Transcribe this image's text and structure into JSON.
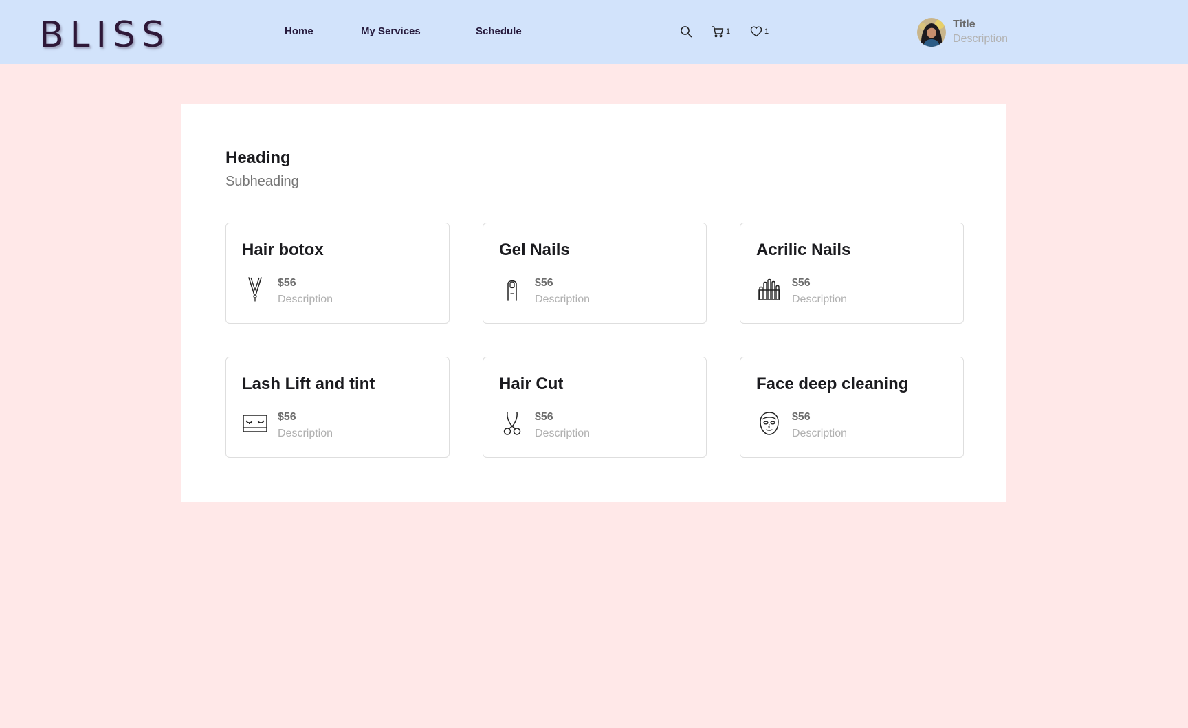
{
  "brand": {
    "logo_text": "BLISS",
    "logo_color": "#2e1838"
  },
  "nav": {
    "items": [
      {
        "label": "Home"
      },
      {
        "label": "My Services"
      },
      {
        "label": "Schedule"
      }
    ]
  },
  "header_actions": {
    "search_icon": "search-icon",
    "cart_icon": "cart-icon",
    "cart_count": "1",
    "favorites_icon": "heart-icon",
    "favorites_count": "1"
  },
  "profile": {
    "title": "Title",
    "description": "Description"
  },
  "main": {
    "heading": "Heading",
    "subheading": "Subheading",
    "services": [
      {
        "name": "Hair botox",
        "price": "$56",
        "description": "Description",
        "icon": "hair-straightener-icon"
      },
      {
        "name": "Gel Nails",
        "price": "$56",
        "description": "Description",
        "icon": "finger-nail-icon"
      },
      {
        "name": "Acrilic Nails",
        "price": "$56",
        "description": "Description",
        "icon": "nail-polish-bottles-icon"
      },
      {
        "name": "Lash Lift and tint",
        "price": "$56",
        "description": "Description",
        "icon": "eyelash-icon"
      },
      {
        "name": "Hair Cut",
        "price": "$56",
        "description": "Description",
        "icon": "scissors-icon"
      },
      {
        "name": "Face deep cleaning",
        "price": "$56",
        "description": "Description",
        "icon": "face-mask-icon"
      }
    ]
  },
  "colors": {
    "header_bg": "#d2e3fb",
    "page_bg": "#ffe8e8",
    "panel_bg": "#ffffff",
    "card_border": "#dedede"
  }
}
